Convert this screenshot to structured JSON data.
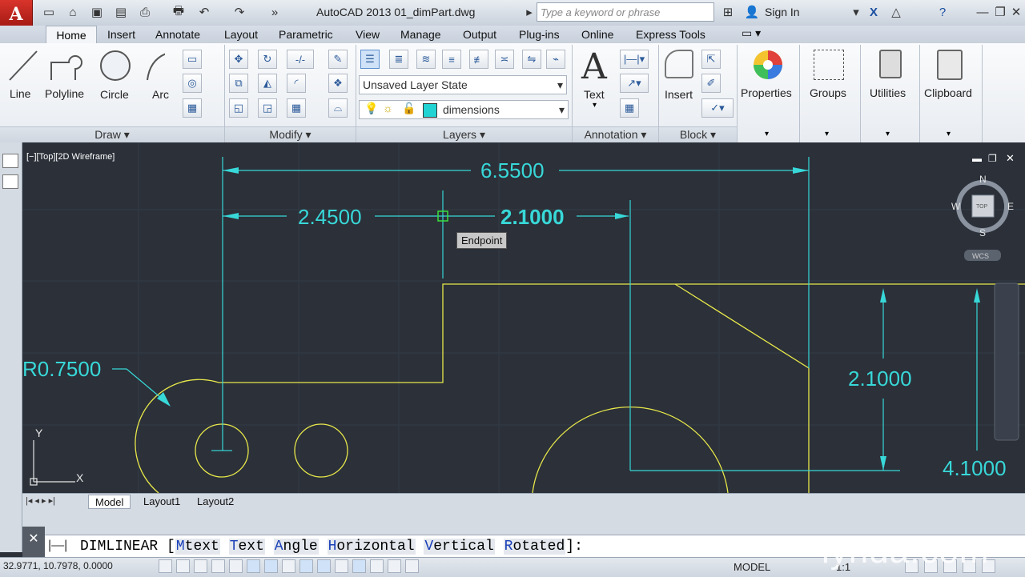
{
  "app": {
    "title": "AutoCAD 2013    01_dimPart.dwg",
    "app_button": "A",
    "search_placeholder": "Type a keyword or phrase",
    "sign_in": "Sign In"
  },
  "tabs": [
    "Home",
    "Insert",
    "Annotate",
    "Layout",
    "Parametric",
    "View",
    "Manage",
    "Output",
    "Plug-ins",
    "Online",
    "Express Tools"
  ],
  "ribbon": {
    "draw": {
      "line": "Line",
      "polyline": "Polyline",
      "circle": "Circle",
      "arc": "Arc",
      "label": "Draw ▾"
    },
    "modify": {
      "label": "Modify ▾"
    },
    "layers": {
      "state": "Unsaved Layer State",
      "current": "dimensions",
      "label": "Layers ▾",
      "layer_color": "#22d3d3"
    },
    "annotation": {
      "text": "Text",
      "label": "Annotation ▾"
    },
    "block": {
      "insert": "Insert",
      "label": "Block ▾"
    },
    "properties": "Properties",
    "groups": "Groups",
    "utilities": "Utilities",
    "clipboard": "Clipboard"
  },
  "viewport": {
    "label": "[−][Top][2D Wireframe]",
    "compass": {
      "n": "N",
      "s": "S",
      "e": "E",
      "w": "W",
      "top": "TOP",
      "wcs": "WCS"
    },
    "tooltip": "Endpoint",
    "dims": {
      "overall": "6.5500",
      "left": "2.4500",
      "right": "2.1000",
      "vertical": "2.1000",
      "vertical2": "4.1000",
      "radius": "R0.7500"
    },
    "ucs": {
      "x": "X",
      "y": "Y"
    },
    "colors": {
      "background": "#2b3039",
      "geometry": "#e8e84a",
      "dimension": "#38d8d8"
    }
  },
  "layout_tabs": [
    "Model",
    "Layout1",
    "Layout2"
  ],
  "command": {
    "name": "DIMLINEAR",
    "options": [
      {
        "key": "M",
        "rest": "text"
      },
      {
        "key": "T",
        "rest": "ext"
      },
      {
        "key": "A",
        "rest": "ngle"
      },
      {
        "key": "H",
        "rest": "orizontal"
      },
      {
        "key": "V",
        "rest": "ertical"
      },
      {
        "key": "R",
        "rest": "otated"
      }
    ],
    "open": "[",
    "close": "]:"
  },
  "status": {
    "coords": "32.9771, 10.7978, 0.0000",
    "model": "MODEL",
    "scale": "1:1"
  },
  "watermark": "lynda.com"
}
